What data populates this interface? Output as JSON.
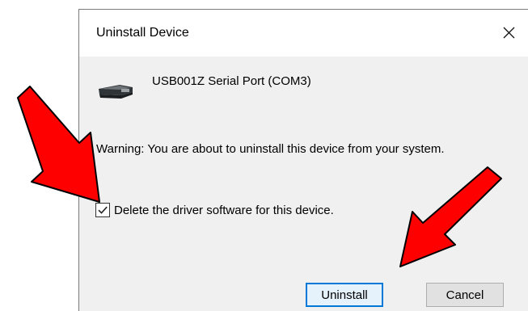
{
  "dialog": {
    "title": "Uninstall Device",
    "close_icon": "close-icon",
    "device_icon": "serial-port-icon",
    "device_name": "USB001Z Serial Port (COM3)",
    "warning": "Warning: You are about to uninstall this device from your system.",
    "checkbox": {
      "label": "Delete the driver software for this device.",
      "checked": true
    },
    "buttons": {
      "uninstall": "Uninstall",
      "cancel": "Cancel"
    }
  },
  "annotations": {
    "arrow_color": "#ff0000",
    "arrows": [
      "arrow-to-checkbox",
      "arrow-to-uninstall-button"
    ]
  }
}
